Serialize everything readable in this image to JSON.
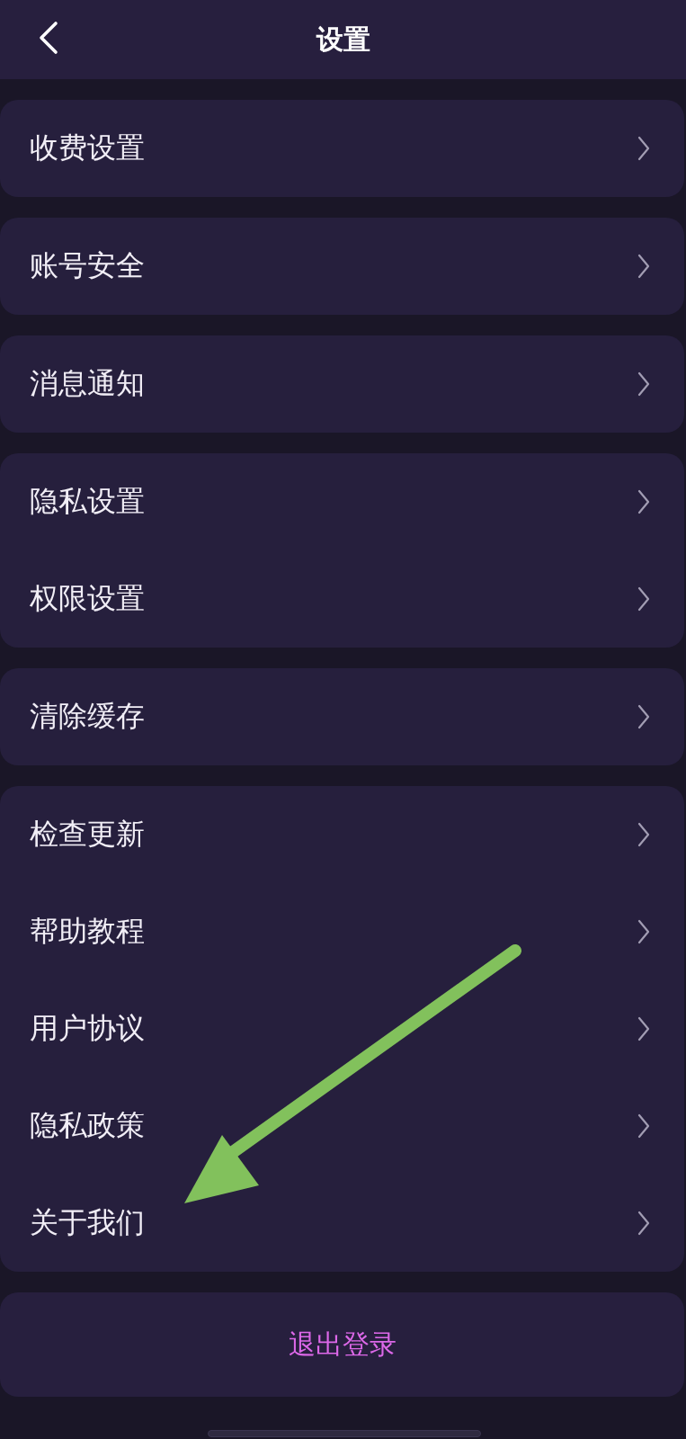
{
  "header": {
    "title": "设置"
  },
  "groups": [
    {
      "items": [
        {
          "label": "收费设置"
        }
      ]
    },
    {
      "items": [
        {
          "label": "账号安全"
        }
      ]
    },
    {
      "items": [
        {
          "label": "消息通知"
        }
      ]
    },
    {
      "items": [
        {
          "label": "隐私设置"
        },
        {
          "label": "权限设置"
        }
      ]
    },
    {
      "items": [
        {
          "label": "清除缓存"
        }
      ]
    },
    {
      "items": [
        {
          "label": "检查更新"
        },
        {
          "label": "帮助教程"
        },
        {
          "label": "用户协议"
        },
        {
          "label": "隐私政策"
        },
        {
          "label": "关于我们"
        }
      ]
    }
  ],
  "logout_button": {
    "label": "退出登录"
  }
}
